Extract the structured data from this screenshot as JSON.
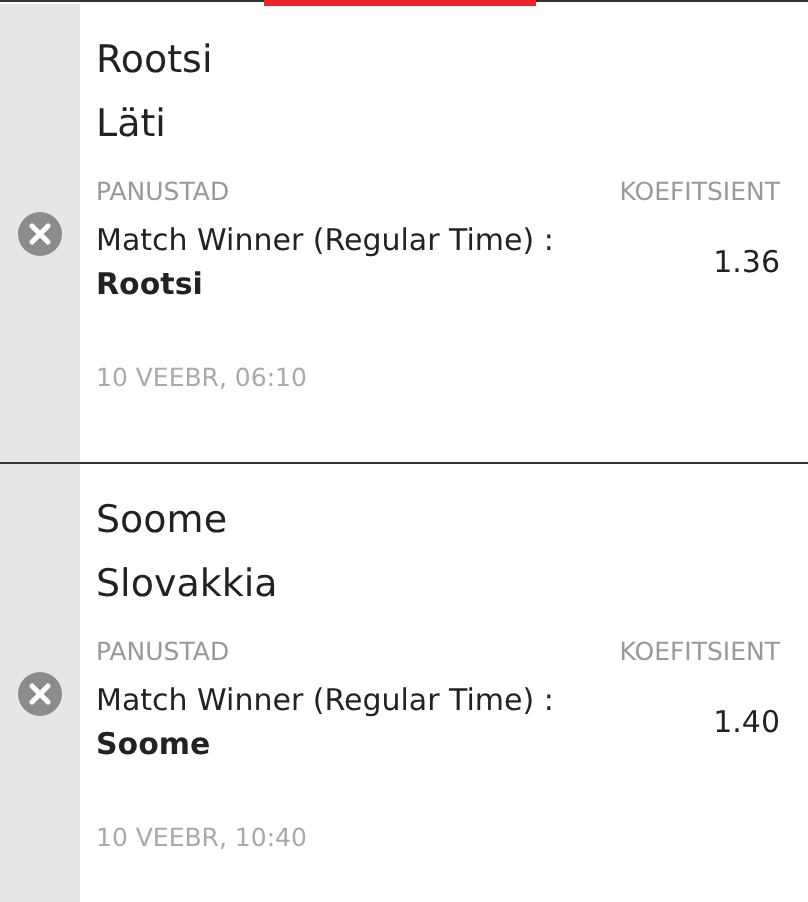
{
  "bets": [
    {
      "home": "Rootsi",
      "away": "Läti",
      "stake_label": "PANUSTAD",
      "odds_label": "KOEFITSIENT",
      "selection": "Match Winner (Regular Time) : **Rootsi**",
      "odds": "1.36",
      "date": "10 VEEBR, 06:10"
    },
    {
      "home": "Soome",
      "away": "Slovakkia",
      "stake_label": "PANUSTAD",
      "odds_label": "KOEFITSIENT",
      "selection": "Match Winner (Regular Time) : **Soome**",
      "odds": "1.40",
      "date": "10 VEEBR, 10:40"
    }
  ]
}
